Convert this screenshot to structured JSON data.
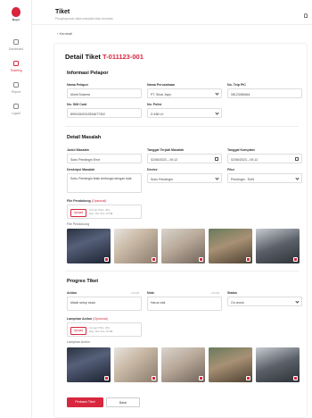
{
  "sidebar": {
    "logo_text": "Mayer",
    "items": [
      {
        "label": "Dashboard",
        "active": false
      },
      {
        "label": "Ticketing",
        "active": true
      },
      {
        "label": "Report",
        "active": false
      },
      {
        "label": "Logout",
        "active": false
      }
    ]
  },
  "header": {
    "title": "Tiket",
    "subtitle": "Penghapusan data masalah atau kendala"
  },
  "back_label": "Kembali",
  "detail": {
    "title_prefix": "Detail Tiket",
    "ticket_id": "T-011123-001"
  },
  "informasi_pelapor": {
    "title": "Informasi Pelapor",
    "nama_pelapor": {
      "label": "Nama Pelapor",
      "value": "Munti Sutarna"
    },
    "nama_perusahaan": {
      "label": "Nama Perusahaan",
      "value": "PT. Sinar Jaya"
    },
    "no_telp": {
      "label": "No. Telp PIC",
      "value": "08123456464"
    },
    "no_sim": {
      "label": "No. SIM Card",
      "value": "89910002012534677302"
    },
    "no_polisi": {
      "label": "No. Polisi",
      "value": "D 456 LK"
    }
  },
  "detail_masalah": {
    "title": "Detail Masalah",
    "judul": {
      "label": "Judul Masalah",
      "value": "Suhu Pendingin Error"
    },
    "tanggal_terjadi": {
      "label": "Tanggal Terjadi Masalah",
      "value": "02/06/2023 – 09.12"
    },
    "tanggal_komplain": {
      "label": "Tanggal Komplain",
      "value": "02/06/2023 – 09.12"
    },
    "deskripsi": {
      "label": "Deskripsi Masalah",
      "value": "Suhu Pendingin tidak berfungsi dengan baik"
    },
    "device": {
      "label": "Device",
      "value": "Suhu Pendingin"
    },
    "fitur": {
      "label": "Fitur",
      "value": "Pendingin · SUN"
    },
    "file_label": "File Pendukung",
    "optional": "(Opsional)",
    "upload": "Upload",
    "format_note": "Format: PNG, JPG",
    "size_note": "Max. File Size 10 MB",
    "gallery_label": "File Pendukung"
  },
  "progres": {
    "title": "Progres Tiket",
    "action": {
      "label": "Action",
      "counter": "16/200",
      "value": "Masih setup stuck"
    },
    "note": {
      "label": "Note",
      "counter": "16/200",
      "value": "Harus visit"
    },
    "status": {
      "label": "Status",
      "value": "On check"
    },
    "lampiran_label": "Lampiran Action",
    "optional": "(Opsional)",
    "upload": "Upload",
    "format_note": "Format: PNG, JPG",
    "size_note": "Max. File Size 10 MB",
    "gallery_label": "Lampiran Action"
  },
  "buttons": {
    "primary": "Perbarui Tiket",
    "secondary": "Batal"
  },
  "colors": {
    "accent": "#d7263d"
  }
}
